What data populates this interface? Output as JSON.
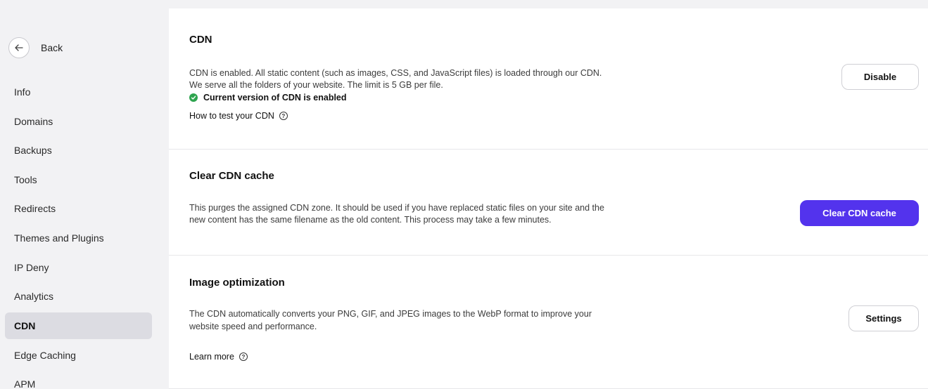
{
  "sidebar": {
    "back_label": "Back",
    "back_icon": "arrow-left-icon",
    "items": [
      {
        "label": "Info"
      },
      {
        "label": "Domains"
      },
      {
        "label": "Backups"
      },
      {
        "label": "Tools"
      },
      {
        "label": "Redirects"
      },
      {
        "label": "Themes and Plugins"
      },
      {
        "label": "IP Deny"
      },
      {
        "label": "Analytics"
      },
      {
        "label": "CDN",
        "active": true
      },
      {
        "label": "Edge Caching"
      },
      {
        "label": "APM"
      }
    ]
  },
  "cdn": {
    "title": "CDN",
    "line1": "CDN is enabled. All static content (such as images, CSS, and JavaScript files) is loaded through our CDN.",
    "line2": "We serve all the folders of your website. The limit is 5 GB per file.",
    "status": "Current version of CDN is enabled",
    "test_link": "How to test your CDN",
    "button": "Disable"
  },
  "clear_cache": {
    "title": "Clear CDN cache",
    "line1": "This purges the assigned CDN zone. It should be used if you have replaced static files on your site and the",
    "line2": "new content has the same filename as the old content. This process may take a few minutes.",
    "button": "Clear CDN cache"
  },
  "image_opt": {
    "title": "Image optimization",
    "line1": "The CDN automatically converts your PNG, GIF, and JPEG images to the WebP format to improve your",
    "line2": "website speed and performance.",
    "learn_more": "Learn more",
    "button": "Settings"
  },
  "colors": {
    "primary": "#5333ed",
    "success": "#2ea44f",
    "sidebar_bg": "#f2f2f4",
    "active_bg": "#dcdce2"
  }
}
